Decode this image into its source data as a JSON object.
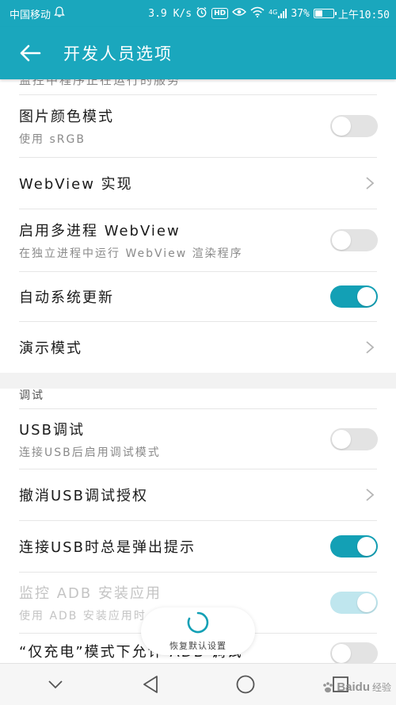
{
  "status_bar": {
    "carrier": "中国移动",
    "speed": "3.9 K/s",
    "hd_badge": "HD",
    "network_type": "4G",
    "battery": "37%",
    "battery_level": 0.37,
    "time": "上午10:50"
  },
  "app_bar": {
    "title": "开发人员选项"
  },
  "settings": {
    "cut_off_text": "监控中程序正在运行的服务",
    "picture_color_mode": {
      "title": "图片颜色模式",
      "subtitle": "使用 sRGB",
      "enabled": false
    },
    "webview_impl": {
      "title": "WebView 实现"
    },
    "multiprocess_webview": {
      "title": "启用多进程 WebView",
      "subtitle": "在独立进程中运行 WebView 渲染程序",
      "enabled": false
    },
    "auto_system_update": {
      "title": "自动系统更新",
      "enabled": true
    },
    "demo_mode": {
      "title": "演示模式"
    },
    "debug_section_title": "调试",
    "usb_debugging": {
      "title": "USB调试",
      "subtitle": "连接USB后启用调试模式",
      "enabled": false
    },
    "revoke_usb_auth": {
      "title": "撤消USB调试授权"
    },
    "usb_connect_prompt": {
      "title": "连接USB时总是弹出提示",
      "enabled": true
    },
    "monitor_adb_install": {
      "title": "监控 ADB 安装应用",
      "subtitle": "使用 ADB 安装应用时",
      "enabled": true
    },
    "charge_only_adb": {
      "title": "“仅充电”模式下允许 ADB 调试",
      "enabled": false
    }
  },
  "restore_button": {
    "label": "恢复默认设置"
  },
  "nav_bar": {
    "back_icon": "triangle-back-icon",
    "home_icon": "circle-home-icon",
    "recents_icon": "square-recents-icon"
  },
  "watermark": {
    "brand": "Baidu",
    "sub": "经验"
  },
  "colors": {
    "accent": "#1aa7bd",
    "toggle_on": "#13a0b5",
    "toggle_off": "#e3e3e3",
    "toggle_disabled": "#bfe6ee"
  }
}
